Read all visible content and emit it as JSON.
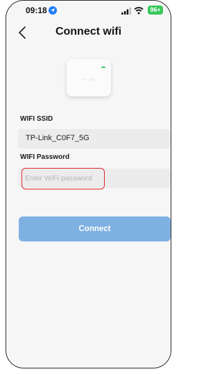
{
  "status_bar": {
    "time": "09:18",
    "battery": "96+",
    "icons": [
      "location-arrow-icon",
      "cellular-signal-icon",
      "wifi-signal-icon",
      "battery-icon"
    ]
  },
  "nav": {
    "back_icon": "chevron-left-icon",
    "title": "Connect wifi"
  },
  "device": {
    "brand": "TP-LINK",
    "led_color": "#3cc864"
  },
  "form": {
    "ssid_label": "WIFI SSID",
    "ssid_value": "TP-Link_C0F7_5G",
    "password_label": "WIFI Password",
    "password_placeholder": "Enter WiFi password",
    "password_value": ""
  },
  "actions": {
    "connect_label": "Connect"
  },
  "colors": {
    "accent": "#7fb0e2",
    "highlight": "#e0262c",
    "battery": "#36c759",
    "location": "#1f7cf6"
  }
}
